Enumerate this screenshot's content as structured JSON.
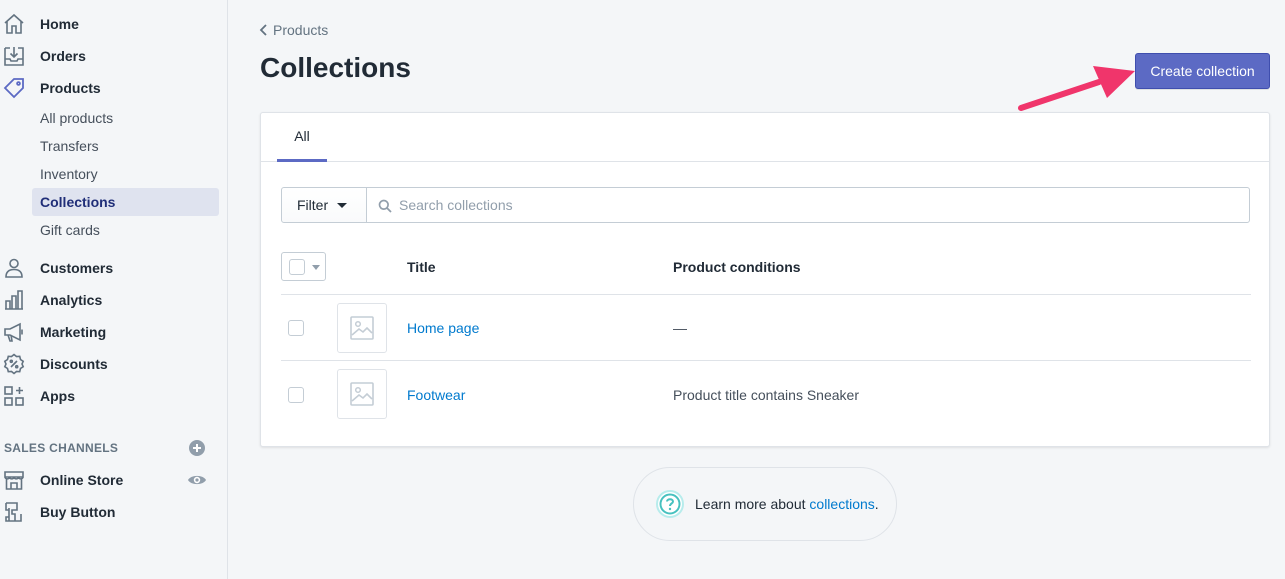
{
  "sidebar": {
    "nav": [
      {
        "label": "Home",
        "icon": "home-icon"
      },
      {
        "label": "Orders",
        "icon": "orders-icon"
      },
      {
        "label": "Products",
        "icon": "tag-icon"
      }
    ],
    "product_subnav": [
      "All products",
      "Transfers",
      "Inventory",
      "Collections",
      "Gift cards"
    ],
    "active_subnav": "Collections",
    "nav2": [
      {
        "label": "Customers",
        "icon": "customers-icon"
      },
      {
        "label": "Analytics",
        "icon": "analytics-icon"
      },
      {
        "label": "Marketing",
        "icon": "megaphone-icon"
      },
      {
        "label": "Discounts",
        "icon": "discount-icon"
      },
      {
        "label": "Apps",
        "icon": "apps-icon"
      }
    ],
    "sales_channels_header": "SALES CHANNELS",
    "channels": [
      {
        "label": "Online Store",
        "icon": "store-icon"
      },
      {
        "label": "Buy Button",
        "icon": "buy-button-icon"
      }
    ]
  },
  "header": {
    "breadcrumb": "Products",
    "title": "Collections",
    "primary_action": "Create collection"
  },
  "tabs": [
    {
      "label": "All",
      "selected": true
    }
  ],
  "filter": {
    "button_label": "Filter",
    "search_placeholder": "Search collections",
    "search_value": ""
  },
  "table": {
    "columns": [
      "Title",
      "Product conditions"
    ],
    "rows": [
      {
        "title": "Home page",
        "conditions": "—"
      },
      {
        "title": "Footwear",
        "conditions": "Product title contains Sneaker"
      }
    ]
  },
  "help": {
    "prefix": "Learn more about ",
    "link": "collections",
    "suffix": "."
  },
  "colors": {
    "primary": "#5c6ac4",
    "link": "#007ace",
    "arrow": "#f0356b",
    "help_icon": "#47c1bf"
  }
}
